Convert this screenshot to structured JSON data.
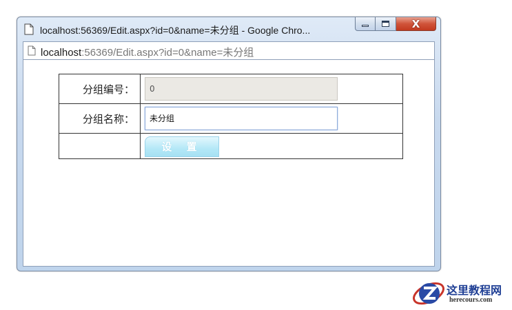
{
  "window": {
    "title": "localhost:56369/Edit.aspx?id=0&name=未分组 - Google Chro...",
    "close_glyph": "X"
  },
  "address": {
    "host": "localhost",
    "rest": ":56369/Edit.aspx?id=0&name=未分组"
  },
  "form": {
    "id_label": "分组编号：",
    "id_value": "0",
    "name_label": "分组名称：",
    "name_value": "未分组",
    "submit_label": "设 置"
  },
  "watermark": {
    "title": "这里教程网",
    "url": "herecours.com"
  },
  "colors": {
    "title_bar": "#c8d9ee",
    "close_button": "#c23a20",
    "submit_button": "#b4e8f7",
    "watermark_blue": "#1f3f95"
  }
}
